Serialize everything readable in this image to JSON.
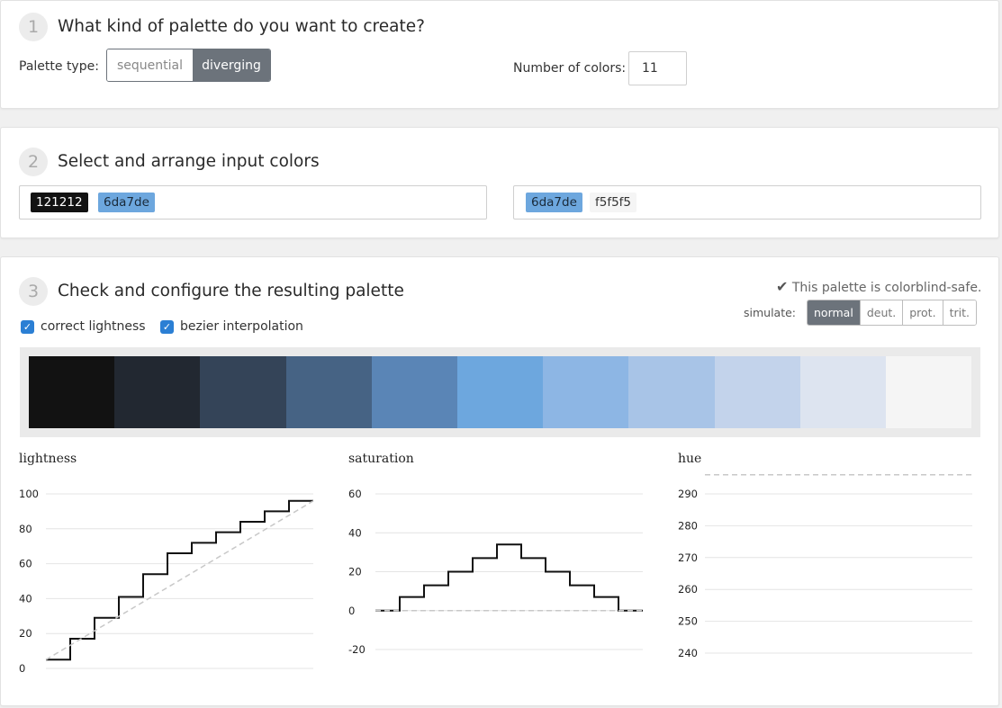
{
  "step1": {
    "number": "1",
    "title": "What kind of palette do you want to create?",
    "palette_type_label": "Palette type:",
    "palette_types": [
      {
        "label": "sequential",
        "active": false
      },
      {
        "label": "diverging",
        "active": true
      }
    ],
    "num_colors_label": "Number of colors:",
    "num_colors_value": "11"
  },
  "step2": {
    "number": "2",
    "title": "Select and arrange input colors",
    "left_colors": [
      {
        "label": "121212",
        "bg": "#121212",
        "fg": "#ffffff"
      },
      {
        "label": "6da7de",
        "bg": "#6da7de",
        "fg": "#1a2a3a"
      }
    ],
    "right_colors": [
      {
        "label": "6da7de",
        "bg": "#6da7de",
        "fg": "#1a2a3a"
      },
      {
        "label": "f5f5f5",
        "bg": "#f5f5f5",
        "fg": "#333333"
      }
    ]
  },
  "step3": {
    "number": "3",
    "title": "Check and configure the resulting palette",
    "colorblind_safe_text": "This palette is colorblind-safe.",
    "correct_lightness_label": "correct lightness",
    "correct_lightness_checked": true,
    "bezier_label": "bezier interpolation",
    "bezier_checked": true,
    "simulate_label": "simulate:",
    "simulate_options": [
      {
        "label": "normal",
        "active": true
      },
      {
        "label": "deut.",
        "active": false
      },
      {
        "label": "prot.",
        "active": false
      },
      {
        "label": "trit.",
        "active": false
      }
    ],
    "palette": [
      "#121212",
      "#222831",
      "#344458",
      "#466384",
      "#5a85b6",
      "#6da7de",
      "#8db6e4",
      "#a8c4e7",
      "#c3d3eb",
      "#dde4f0",
      "#f5f5f5"
    ]
  },
  "colors": {
    "accent": "#6c737b",
    "checkbox": "#2b7fd4"
  },
  "icons": {
    "check": "check-icon",
    "checkbox": "checkbox-checked-icon"
  },
  "chart_data": [
    {
      "type": "line",
      "title": "lightness",
      "step": true,
      "x": [
        0,
        1,
        2,
        3,
        4,
        5,
        6,
        7,
        8,
        9,
        10
      ],
      "series": [
        {
          "values": [
            5,
            17,
            29,
            41,
            54,
            66,
            72,
            78,
            84,
            90,
            96
          ]
        },
        {
          "values": [
            5,
            14.1,
            23.2,
            32.3,
            41.4,
            50.5,
            59.6,
            68.7,
            77.8,
            86.9,
            96
          ],
          "style": "dashed"
        }
      ],
      "yticks": [
        0,
        20,
        40,
        60,
        80,
        100
      ],
      "ylim": [
        0,
        100
      ],
      "grid": true
    },
    {
      "type": "line",
      "title": "saturation",
      "step": true,
      "x": [
        0,
        1,
        2,
        3,
        4,
        5,
        6,
        7,
        8,
        9,
        10
      ],
      "series": [
        {
          "values": [
            0,
            7,
            13,
            20,
            27,
            34,
            27,
            20,
            13,
            7,
            0
          ]
        },
        {
          "values": [
            0,
            0,
            0,
            0,
            0,
            0,
            0,
            0,
            0,
            0,
            0
          ],
          "style": "dashed"
        }
      ],
      "yticks": [
        -20,
        0,
        20,
        40,
        60
      ],
      "ylim": [
        -20,
        60
      ],
      "grid": true
    },
    {
      "type": "line",
      "title": "hue",
      "step": true,
      "x": [
        0,
        1,
        2,
        3,
        4,
        5,
        6,
        7,
        8,
        9,
        10
      ],
      "series": [
        {
          "values": [
            296,
            296,
            296,
            296,
            296,
            296,
            296,
            296,
            296,
            296,
            296
          ],
          "style": "dashed"
        }
      ],
      "yticks": [
        240,
        250,
        260,
        270,
        280,
        290
      ],
      "ylim": [
        240,
        290
      ],
      "grid": true
    }
  ]
}
